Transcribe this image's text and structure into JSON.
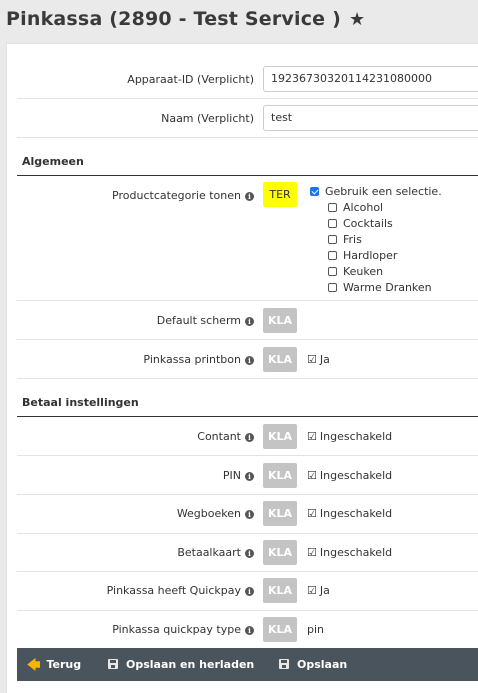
{
  "page": {
    "title": "Pinkassa (2890 - Test Service )",
    "star_icon": "star-icon"
  },
  "fields": {
    "device_id": {
      "label": "Apparaat-ID (Verplicht)",
      "value": "19236730320114231080000"
    },
    "name": {
      "label": "Naam (Verplicht)",
      "value": "test"
    }
  },
  "sections": {
    "general": "Algemeen",
    "payment": "Betaal instellingen"
  },
  "general": {
    "product_category": {
      "label": "Productcategorie tonen",
      "badge": "TER",
      "use_selection": "Gebruik een selectie.",
      "options": [
        "Alcohol",
        "Cocktails",
        "Fris",
        "Hardloper",
        "Keuken",
        "Warme Dranken"
      ]
    },
    "default_screen": {
      "label": "Default scherm",
      "badge": "KLA"
    },
    "printbon": {
      "label": "Pinkassa printbon",
      "badge": "KLA",
      "value": "Ja"
    }
  },
  "payment": {
    "contant": {
      "label": "Contant",
      "badge": "KLA",
      "value": "Ingeschakeld"
    },
    "pin": {
      "label": "PIN",
      "badge": "KLA",
      "value": "Ingeschakeld"
    },
    "wegboeken": {
      "label": "Wegboeken",
      "badge": "KLA",
      "value": "Ingeschakeld"
    },
    "betaalkaart": {
      "label": "Betaalkaart",
      "badge": "KLA",
      "value": "Ingeschakeld"
    },
    "quickpay": {
      "label": "Pinkassa heeft Quickpay",
      "badge": "KLA",
      "value": "Ja"
    },
    "quickpay_type": {
      "label": "Pinkassa quickpay type",
      "badge": "KLA",
      "value": "pin"
    }
  },
  "footer": {
    "back": "Terug",
    "save_reload": "Opslaan en herladen",
    "save": "Opslaan"
  },
  "colors": {
    "badge_kla": "#c4c4c4",
    "badge_ter": "#ffff00",
    "footer_bg": "#4a545c",
    "back_arrow": "#f7b500",
    "checkbox_accent": "#1a73e8"
  }
}
